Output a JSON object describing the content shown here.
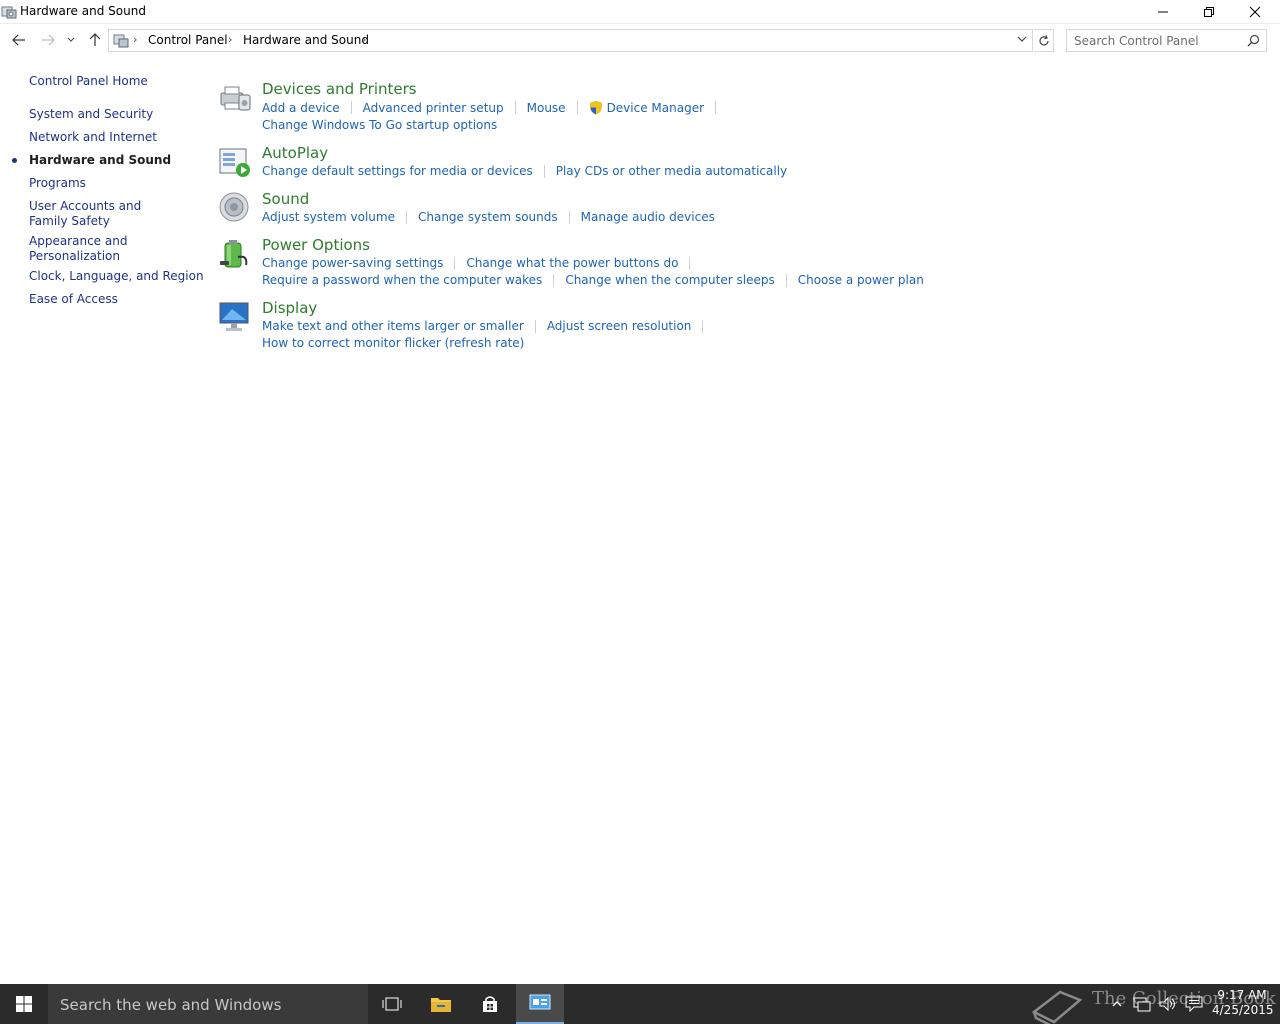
{
  "window": {
    "title": "Hardware and Sound",
    "minimize_icon": "minimize-icon",
    "restore_icon": "restore-icon",
    "close_icon": "close-icon"
  },
  "address_bar": {
    "breadcrumbs": [
      "Control Panel",
      "Hardware and Sound"
    ],
    "search_placeholder": "Search Control Panel"
  },
  "sidebar": {
    "items": [
      {
        "label": "Control Panel Home"
      },
      {
        "label": "System and Security"
      },
      {
        "label": "Network and Internet"
      },
      {
        "label": "Hardware and Sound",
        "active": true
      },
      {
        "label": "Programs"
      },
      {
        "label": "User Accounts and Family Safety"
      },
      {
        "label": "Appearance and Personalization"
      },
      {
        "label": "Clock, Language, and Region"
      },
      {
        "label": "Ease of Access"
      }
    ]
  },
  "categories": [
    {
      "title": "Devices and Printers",
      "icon": "printer-icon",
      "links": [
        "Add a device",
        "Advanced printer setup",
        "Mouse",
        "Device Manager",
        "Change Windows To Go startup options"
      ]
    },
    {
      "title": "AutoPlay",
      "icon": "autoplay-icon",
      "links": [
        "Change default settings for media or devices",
        "Play CDs or other media automatically"
      ]
    },
    {
      "title": "Sound",
      "icon": "speaker-icon",
      "links": [
        "Adjust system volume",
        "Change system sounds",
        "Manage audio devices"
      ]
    },
    {
      "title": "Power Options",
      "icon": "battery-icon",
      "links": [
        "Change power-saving settings",
        "Change what the power buttons do",
        "Require a password when the computer wakes",
        "Change when the computer sleeps",
        "Choose a power plan"
      ]
    },
    {
      "title": "Display",
      "icon": "monitor-icon",
      "links": [
        "Make text and other items larger or smaller",
        "Adjust screen resolution",
        "How to correct monitor flicker (refresh rate)"
      ]
    }
  ],
  "taskbar": {
    "search_placeholder": "Search the web and Windows",
    "time": "9:17 AM",
    "date": "4/25/2015",
    "watermark": "The Collection Book"
  },
  "colors": {
    "category_title": "#2d7d2d",
    "link": "#1e64b4",
    "sidebar_link": "#1e3287",
    "taskbar": "#2b2b2b"
  }
}
